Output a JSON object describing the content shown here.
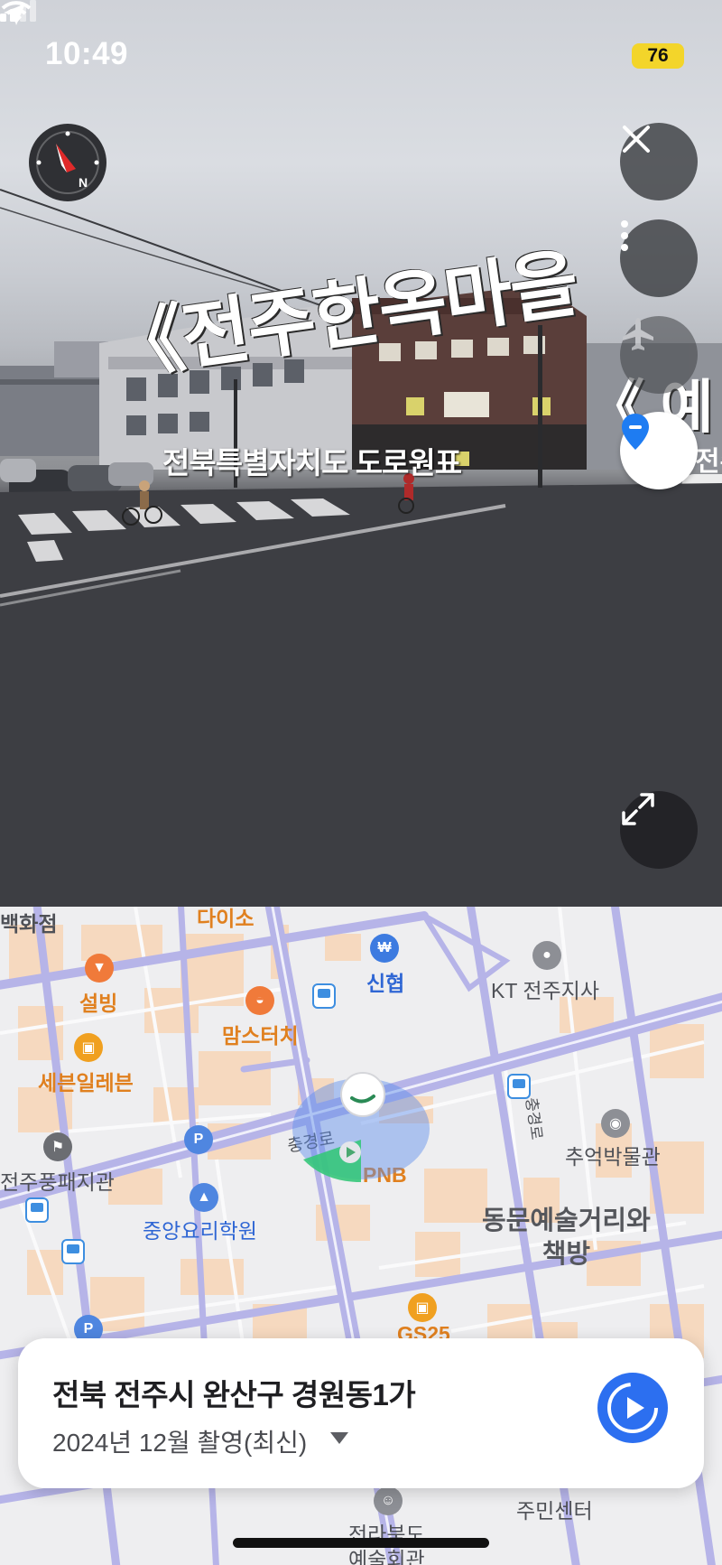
{
  "status_bar": {
    "time": "10:49",
    "battery": "76"
  },
  "pano": {
    "sign_main": "《전주한옥마을",
    "sign_sub": "전북특별자치도 도로원표",
    "sign_right": "《 예",
    "sign_right_sub": "전주",
    "compass_icon": "compass-icon",
    "compass_label": "N"
  },
  "map": {
    "pois": [
      {
        "label": "백화점",
        "kind": "gray"
      },
      {
        "label": "다이소",
        "kind": "orange"
      },
      {
        "label": "설빙",
        "kind": "orange"
      },
      {
        "label": "맘스터치",
        "kind": "orange"
      },
      {
        "label": "신협",
        "kind": "blue"
      },
      {
        "label": "KT 전주지사",
        "kind": "gray"
      },
      {
        "label": "세븐일레븐",
        "kind": "orange"
      },
      {
        "label": "PNB",
        "kind": "orange"
      },
      {
        "label": "추억박물관",
        "kind": "gray"
      },
      {
        "label": "전주풍패지관",
        "kind": "gray"
      },
      {
        "label": "중앙요리학원",
        "kind": "blue"
      },
      {
        "label": "GS25",
        "kind": "orange"
      },
      {
        "label": "주민센터",
        "kind": "gray"
      },
      {
        "label": "전라북도",
        "kind": "gray"
      },
      {
        "label": "예술회관",
        "kind": "gray"
      }
    ],
    "area_label_line1": "동문예술거리와",
    "area_label_line2": "책방",
    "road_labels": [
      "충경로",
      "충경로"
    ]
  },
  "info_card": {
    "address": "전북 전주시 완산구 경원동1가",
    "capture_date": "2024년 12월 촬영(최신)"
  },
  "colors": {
    "accent": "#2c6ff0",
    "road": "#b6b4e8",
    "building": "#f6d9bf",
    "battery": "#f3d52a"
  }
}
